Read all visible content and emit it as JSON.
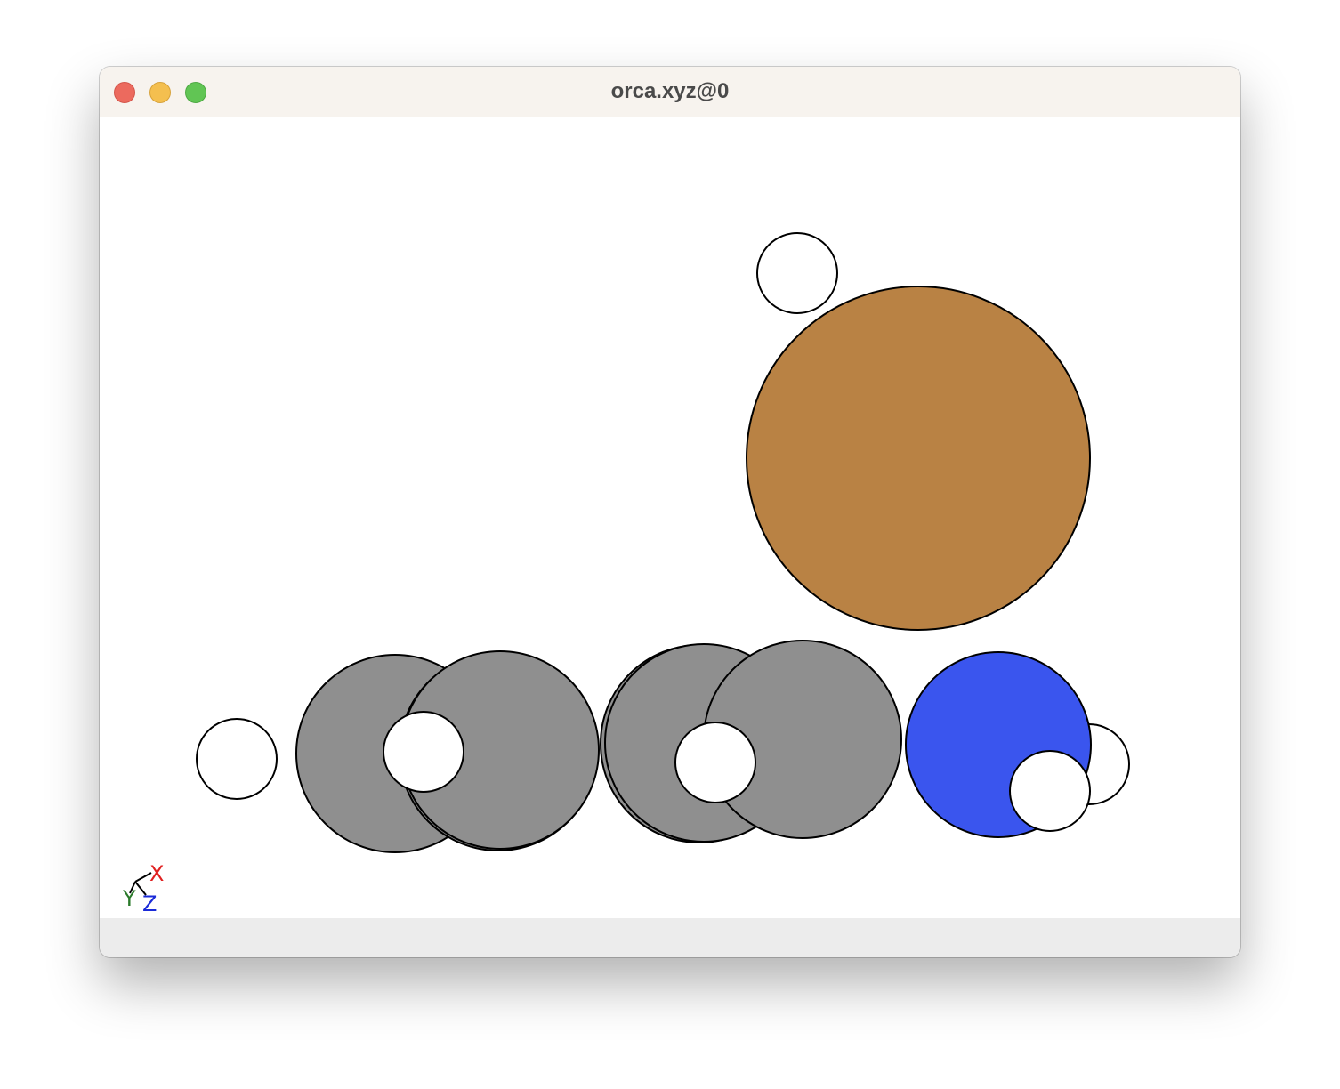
{
  "window": {
    "title": "orca.xyz@0"
  },
  "controls": {
    "close": "close",
    "minimize": "minimize",
    "maximize": "maximize"
  },
  "molecule": {
    "atom_colors": {
      "hydrogen": "#ffffff",
      "carbon": "#8f8f8f",
      "nitrogen": "#3a55ee",
      "bromine": "#b98244",
      "outline": "#000000"
    }
  },
  "axes": {
    "x_label": "X",
    "y_label": "Y",
    "z_label": "Z",
    "x_color": "#e02020",
    "y_color": "#2a7a2a",
    "z_color": "#1a2ad8"
  }
}
